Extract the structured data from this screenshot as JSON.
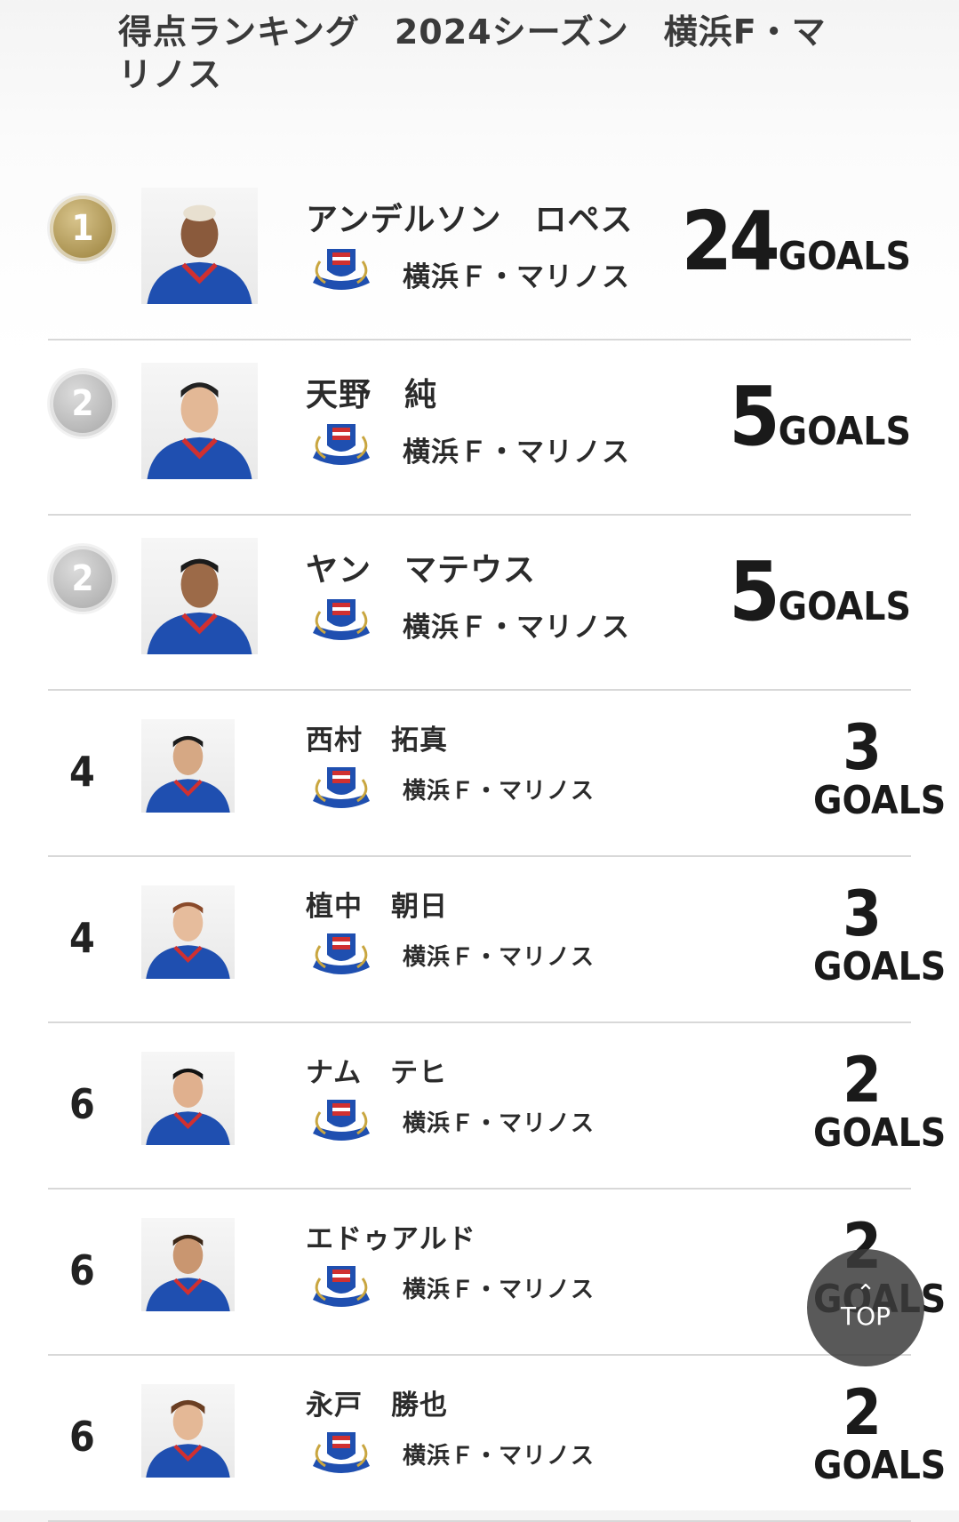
{
  "page": {
    "title": "得点ランキング　2024シーズン　横浜F・マリノス"
  },
  "goals_unit": "GOALS",
  "players": [
    {
      "rank": "1",
      "medal": "gold",
      "name": "アンデルソン　ロペス",
      "club": "横浜Ｆ・マリノス",
      "goals": "24"
    },
    {
      "rank": "2",
      "medal": "silver",
      "name": "天野　純",
      "club": "横浜Ｆ・マリノス",
      "goals": "5"
    },
    {
      "rank": "2",
      "medal": "silver",
      "name": "ヤン　マテウス",
      "club": "横浜Ｆ・マリノス",
      "goals": "5"
    },
    {
      "rank": "4",
      "medal": "",
      "name": "西村　拓真",
      "club": "横浜Ｆ・マリノス",
      "goals": "3"
    },
    {
      "rank": "4",
      "medal": "",
      "name": "植中　朝日",
      "club": "横浜Ｆ・マリノス",
      "goals": "3"
    },
    {
      "rank": "6",
      "medal": "",
      "name": "ナム　テヒ",
      "club": "横浜Ｆ・マリノス",
      "goals": "2"
    },
    {
      "rank": "6",
      "medal": "",
      "name": "エドゥアルド",
      "club": "横浜Ｆ・マリノス",
      "goals": "2"
    },
    {
      "rank": "6",
      "medal": "",
      "name": "永戸　勝也",
      "club": "横浜Ｆ・マリノス",
      "goals": "2"
    }
  ],
  "top_button": {
    "arrow": "⌃",
    "label": "TOP"
  },
  "colors": {
    "gold": "#a8904e",
    "silver": "#b4b4b4",
    "kit_blue": "#1f4fb0",
    "kit_red": "#d03030"
  },
  "icons": [
    "medal-icon",
    "club-crest-icon",
    "player-photo",
    "chevron-up-icon"
  ]
}
